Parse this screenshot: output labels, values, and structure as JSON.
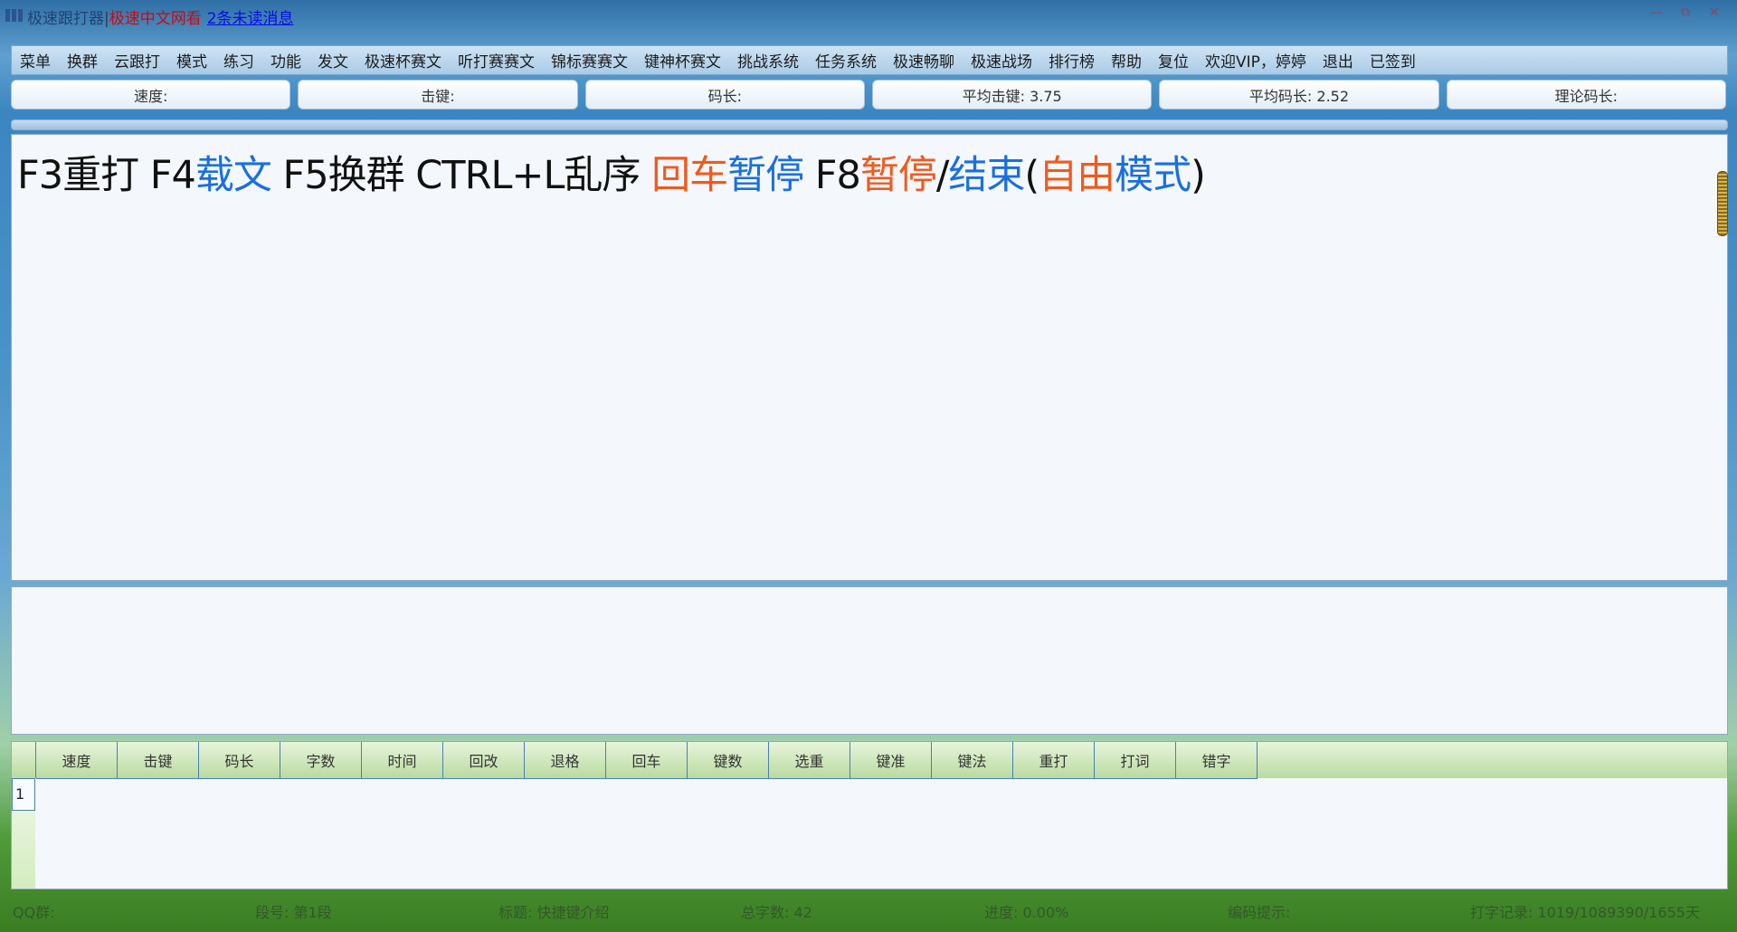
{
  "title": {
    "app_name": "极速跟打器",
    "sep": "|",
    "site": "极速中文网看",
    "unread": "2条未读消息"
  },
  "menu": [
    "菜单",
    "换群",
    "云跟打",
    "模式",
    "练习",
    "功能",
    "发文",
    "极速杯赛文",
    "听打赛赛文",
    "锦标赛赛文",
    "键神杯赛文",
    "挑战系统",
    "任务系统",
    "极速畅聊",
    "极速战场",
    "排行榜",
    "帮助",
    "复位",
    "欢迎VIP，婷婷",
    "退出",
    "已签到"
  ],
  "stats": [
    "速度:",
    "击键:",
    "码长:",
    "平均击键: 3.75",
    "平均码长: 2.52",
    "理论码长:"
  ],
  "progress": {
    "fraction": 0.0
  },
  "hint": {
    "p1": "F3重打 F4",
    "p2": "载文",
    "p3": " F5换群 CTRL+L乱序 ",
    "p4": "回车",
    "p5": "暂停",
    "p6": " F8",
    "p7": "暂停",
    "p8": "/",
    "p9": "结束",
    "p10": "(",
    "p11": "自由",
    "p12": "模式",
    "p13": ")"
  },
  "grid": {
    "columns": [
      "速度",
      "击键",
      "码长",
      "字数",
      "时间",
      "回改",
      "退格",
      "回车",
      "键数",
      "选重",
      "键准",
      "键法",
      "重打",
      "打词",
      "错字"
    ],
    "rows": [
      "1"
    ]
  },
  "status": {
    "qq": "QQ群:",
    "para": "段号: 第1段",
    "title": "标题: 快捷键介绍",
    "total": "总字数: 42",
    "progress": "进度: 0.00%",
    "code_hint": "编码提示:",
    "record": "打字记录: 1019/1089390/1655天"
  },
  "icons": {
    "app": "grid-icon",
    "minimize": "minimize-icon",
    "restore": "restore-icon",
    "close": "close-icon"
  }
}
